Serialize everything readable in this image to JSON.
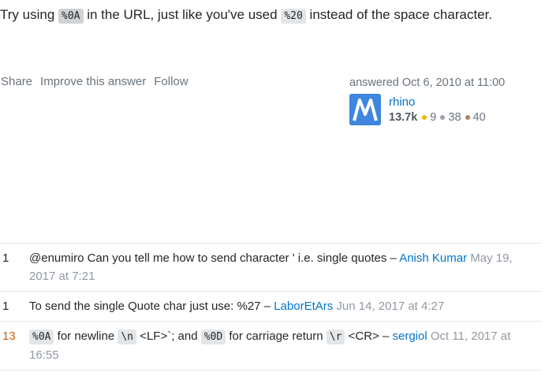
{
  "answer": {
    "t1": "Try using ",
    "code1": "%0A",
    "t2": " in the URL, just like you've used ",
    "code2": "%20",
    "t3": " instead of the space character."
  },
  "post_menu": {
    "share": "Share",
    "improve": "Improve this answer",
    "follow": "Follow"
  },
  "user": {
    "action": "answered Oct 6, 2010 at 11:00",
    "avatar_letter": "M",
    "name": "rhino",
    "reputation": "13.7k",
    "gold": "9",
    "silver": "38",
    "bronze": "40"
  },
  "colors": {
    "gold": "#f1b600",
    "silver": "#9a9fa4",
    "bronze": "#ab825f",
    "link": "#0074cc",
    "hot_score": "#c0610d"
  },
  "comments": [
    {
      "score": "1",
      "text": "@enumiro Can you tell me how to send character ' i.e. single quotes",
      "dash": " – ",
      "user": "Anish Kumar",
      "date": "May 19, 2017 at 7:21"
    },
    {
      "score": "1",
      "text": "To send the single Quote char just use: %27",
      "dash": " – ",
      "user": "LaborEtArs",
      "date": "Jun 14, 2017 at 4:27"
    },
    {
      "score": "13",
      "code1": "%0A",
      "t1": " for newline ",
      "code2": "\\n",
      "t2": " <LF>`; and ",
      "code3": "%0D",
      "t3": " for carriage return ",
      "code4": "\\r",
      "t4": " <CR>",
      "dash": " – ",
      "user": "sergiol",
      "date": "Oct 11, 2017 at 16:55"
    }
  ]
}
